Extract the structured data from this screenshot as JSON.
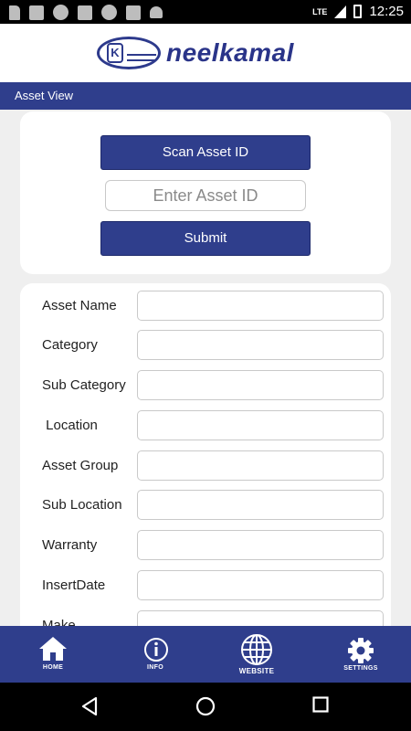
{
  "status_bar": {
    "network": "LTE",
    "time": "12:25"
  },
  "header": {
    "brand": "neelkamal",
    "logo_colors": {
      "primary": "#2a3489"
    }
  },
  "page": {
    "title": "Asset View"
  },
  "scan_card": {
    "scan_button": "Scan Asset ID",
    "asset_id_placeholder": "Enter Asset ID",
    "submit_button": "Submit"
  },
  "form": {
    "fields": [
      {
        "label": "Asset Name",
        "value": ""
      },
      {
        "label": "Category",
        "value": ""
      },
      {
        "label": "Sub Category",
        "value": ""
      },
      {
        "label": " Location",
        "value": ""
      },
      {
        "label": "Asset Group",
        "value": ""
      },
      {
        "label": "Sub Location",
        "value": ""
      },
      {
        "label": "Warranty",
        "value": ""
      },
      {
        "label": "InsertDate",
        "value": ""
      },
      {
        "label": "Make",
        "value": ""
      }
    ]
  },
  "bottom_nav": {
    "items": [
      {
        "label": "HOME",
        "icon": "home-icon"
      },
      {
        "label": "INFO",
        "icon": "info-icon"
      },
      {
        "label": "WEBSITE",
        "icon": "globe-icon"
      },
      {
        "label": "SETTINGS",
        "icon": "gear-icon"
      }
    ]
  },
  "colors": {
    "accent": "#2f3e8c",
    "background": "#efefef",
    "card": "#ffffff"
  }
}
